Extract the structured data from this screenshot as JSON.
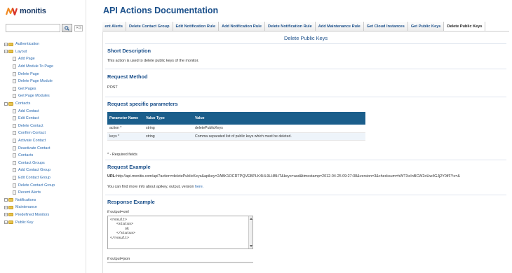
{
  "app": {
    "name": "monitis"
  },
  "colors": {
    "brand": "#1a3a66",
    "accent": "#1a4f8a",
    "table_header": "#1b5e8b",
    "link": "#2a6ab0",
    "logo_orange": "#f08a24",
    "logo_red": "#d9342b"
  },
  "search": {
    "value": "",
    "clear_label": "✕⊡"
  },
  "tree": [
    {
      "label": "Authentication",
      "level": 0,
      "expander": "+",
      "icon": "folder-icon"
    },
    {
      "label": "Layout",
      "level": 0,
      "expander": "−",
      "icon": "folder-icon"
    },
    {
      "label": "Add Page",
      "level": 1,
      "icon": "page-icon"
    },
    {
      "label": "Add Module To Page",
      "level": 1,
      "icon": "page-icon"
    },
    {
      "label": "Delete Page",
      "level": 1,
      "icon": "page-icon"
    },
    {
      "label": "Delete Page Module",
      "level": 1,
      "icon": "page-icon"
    },
    {
      "label": "Get Pages",
      "level": 1,
      "icon": "page-icon"
    },
    {
      "label": "Get Page Modules",
      "level": 1,
      "icon": "page-icon"
    },
    {
      "label": "Contacts",
      "level": 0,
      "expander": "−",
      "icon": "folder-icon"
    },
    {
      "label": "Add Contact",
      "level": 1,
      "icon": "page-icon"
    },
    {
      "label": "Edit Contact",
      "level": 1,
      "icon": "page-icon"
    },
    {
      "label": "Delete Contact",
      "level": 1,
      "icon": "page-icon"
    },
    {
      "label": "Confirm Contact",
      "level": 1,
      "icon": "page-icon"
    },
    {
      "label": "Activate Contact",
      "level": 1,
      "icon": "page-icon"
    },
    {
      "label": "Deactivate Contact",
      "level": 1,
      "icon": "page-icon"
    },
    {
      "label": "Contacts",
      "level": 1,
      "icon": "page-icon"
    },
    {
      "label": "Contact Groups",
      "level": 1,
      "icon": "page-icon"
    },
    {
      "label": "Add Contact Group",
      "level": 1,
      "icon": "page-icon"
    },
    {
      "label": "Edit Contact Group",
      "level": 1,
      "icon": "page-icon"
    },
    {
      "label": "Delete Contact Group",
      "level": 1,
      "icon": "page-icon"
    },
    {
      "label": "Recent Alerts",
      "level": 1,
      "icon": "page-icon"
    },
    {
      "label": "Notifications",
      "level": 0,
      "expander": "+",
      "icon": "folder-icon"
    },
    {
      "label": "Maintenance",
      "level": 0,
      "expander": "+",
      "icon": "folder-icon"
    },
    {
      "label": "Predefined Monitors",
      "level": 0,
      "expander": "+",
      "icon": "folder-icon"
    },
    {
      "label": "Public Key",
      "level": 0,
      "expander": "+",
      "icon": "folder-icon"
    }
  ],
  "main": {
    "title": "API Actions Documentation",
    "tabs": [
      {
        "label": "ent Alerts"
      },
      {
        "label": "Delete Contact Group"
      },
      {
        "label": "Edit Notification Rule"
      },
      {
        "label": "Add Notification Rule"
      },
      {
        "label": "Delete Notification Rule"
      },
      {
        "label": "Add Maintenance Rule"
      },
      {
        "label": "Get Cloud Instances"
      },
      {
        "label": "Get Public Keys"
      },
      {
        "label": "Delete Public Keys",
        "active": true
      }
    ],
    "doc_heading": "Delete Public Keys",
    "short_description": {
      "title": "Short Description",
      "text": "This action is used to delete public keys of the monitor."
    },
    "request_method": {
      "title": "Request Method",
      "value": "POST"
    },
    "params": {
      "title": "Request specific parameters",
      "headers": [
        "Parameter Name",
        "Value Type",
        "Value"
      ],
      "rows": [
        [
          "action *",
          "string",
          "deletePublicKeys"
        ],
        [
          "keys *",
          "string",
          "Comma separated list of public keys which must be deleted."
        ]
      ],
      "footnote": "* - Required fields"
    },
    "request_example": {
      "title": "Request Example",
      "url_label": "URL:",
      "url": "http://api.monitis.com/api?action=deletePublicKeys&apikey=2ABK1OCRTPQVEBPLK4HL9LHBHT&keys=asd&timestamp=2012-04-25 09:27:38&version=3&checksum=hWTXeInBCW2oUw4GJj2Y0lfFYs=&",
      "more_text": "You can find more info about apikey, output, version ",
      "more_link": "here."
    },
    "response_example": {
      "title": "Response Example",
      "xml_label": "if output=xml",
      "xml": "<result>\n   <status>\n       ok\n   </status>\n</result>",
      "json_label": "if output=json"
    }
  }
}
